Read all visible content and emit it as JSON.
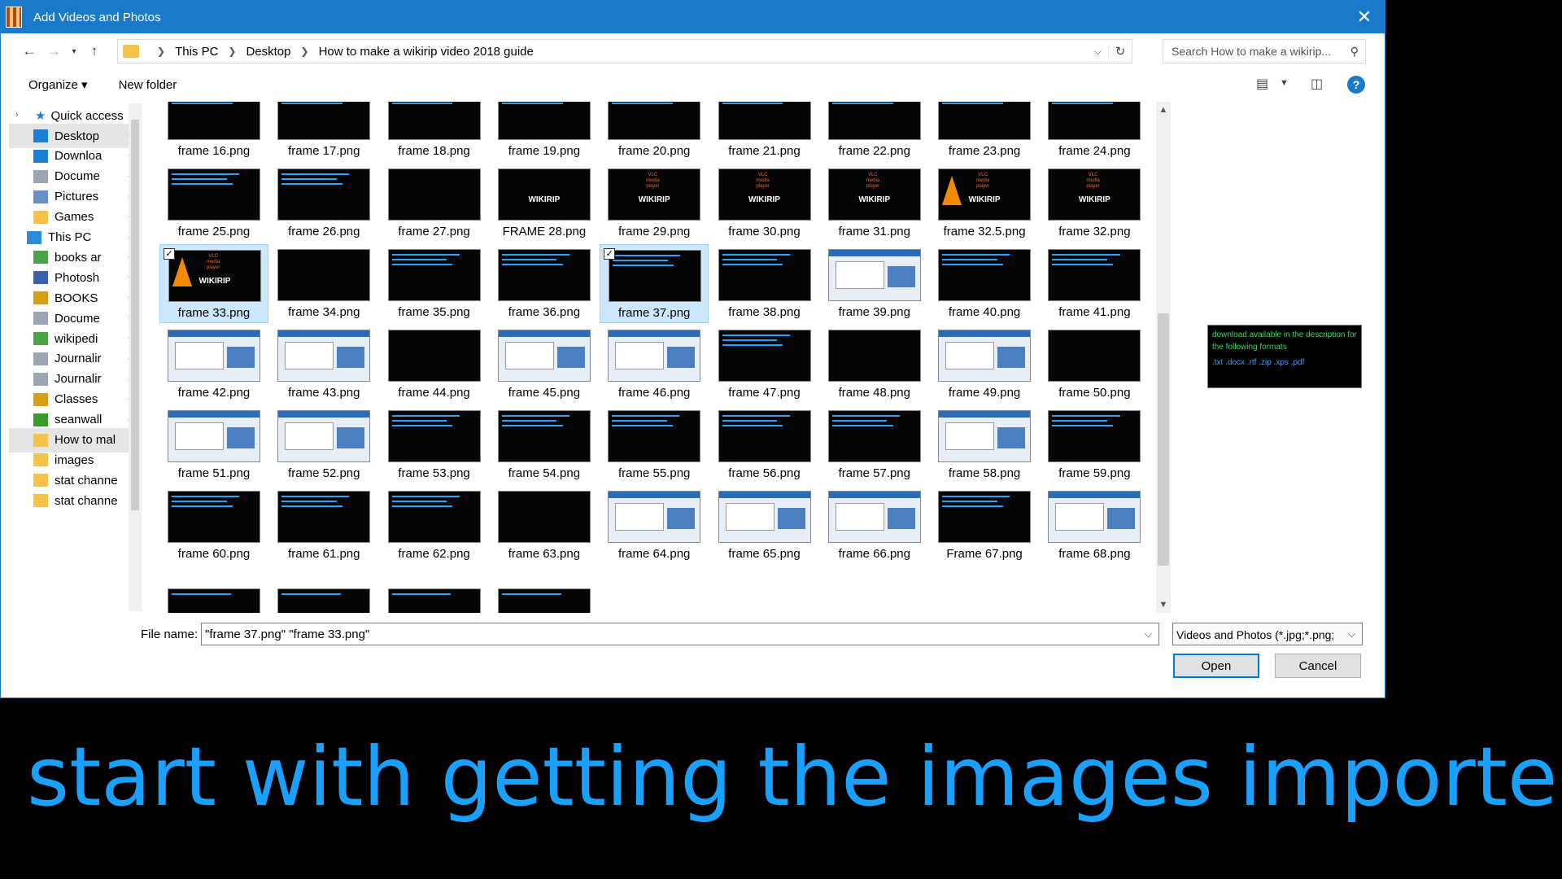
{
  "window": {
    "title": "Add Videos and Photos"
  },
  "address": {
    "crumbs": [
      "This PC",
      "Desktop",
      "How to make a wikirip video 2018 guide"
    ]
  },
  "search": {
    "placeholder": "Search How to make a wikirip..."
  },
  "toolbar": {
    "organize": "Organize ▾",
    "new_folder": "New folder"
  },
  "nav_pane": {
    "quick_access": "Quick access",
    "items": [
      {
        "label": "Desktop",
        "icon": "desktop-icon",
        "color": "#1b7fd6"
      },
      {
        "label": "Downloa",
        "icon": "download-icon",
        "color": "#1b7fd6"
      },
      {
        "label": "Docume",
        "icon": "document-icon",
        "color": "#9aa6b3"
      },
      {
        "label": "Pictures",
        "icon": "pictures-icon",
        "color": "#6a8fc2"
      },
      {
        "label": "Games",
        "icon": "folder-icon",
        "color": "#f6c34a"
      },
      {
        "label": "This PC",
        "icon": "computer-icon",
        "color": "#2a8bd8"
      },
      {
        "label": "books ar",
        "icon": "books-icon",
        "color": "#4aa34a"
      },
      {
        "label": "Photosh",
        "icon": "photoshop-icon",
        "color": "#3d5fb0"
      },
      {
        "label": "BOOKS",
        "icon": "books-folder-icon",
        "color": "#d4a017"
      },
      {
        "label": "Docume",
        "icon": "document-icon",
        "color": "#9aa6b3"
      },
      {
        "label": "wikipedi",
        "icon": "wikipedia-icon",
        "color": "#4aa34a"
      },
      {
        "label": "Journalir",
        "icon": "journal-icon",
        "color": "#9aa6b3"
      },
      {
        "label": "Journalir",
        "icon": "journal-icon",
        "color": "#9aa6b3"
      },
      {
        "label": "Classes",
        "icon": "classes-icon",
        "color": "#d4a017"
      },
      {
        "label": "seanwall",
        "icon": "tree-icon",
        "color": "#3a9a2a"
      },
      {
        "label": "How to mal",
        "icon": "folder-icon",
        "color": "#f6c34a"
      },
      {
        "label": "images",
        "icon": "folder-icon",
        "color": "#f6c34a"
      },
      {
        "label": "stat channe",
        "icon": "folder-icon",
        "color": "#f6c34a"
      },
      {
        "label": "stat channe",
        "icon": "folder-icon",
        "color": "#f6c34a"
      }
    ]
  },
  "files": [
    [
      "frame 16.png",
      "frame 17.png",
      "frame 18.png",
      "frame 19.png",
      "frame 20.png",
      "frame 21.png",
      "frame 22.png",
      "frame 23.png",
      "frame 24.png"
    ],
    [
      "frame 25.png",
      "frame 26.png",
      "frame 27.png",
      "FRAME 28.png",
      "frame 29.png",
      "frame 30.png",
      "frame 31.png",
      "frame 32.5.png",
      "frame 32.png"
    ],
    [
      "frame 33.png",
      "frame 34.png",
      "frame 35.png",
      "frame 36.png",
      "frame 37.png",
      "frame 38.png",
      "frame 39.png",
      "frame 40.png",
      "frame 41.png"
    ],
    [
      "frame 42.png",
      "frame 43.png",
      "frame 44.png",
      "frame 45.png",
      "frame 46.png",
      "frame 47.png",
      "frame 48.png",
      "frame 49.png",
      "frame 50.png"
    ],
    [
      "frame 51.png",
      "frame 52.png",
      "frame 53.png",
      "frame 54.png",
      "frame 55.png",
      "frame 56.png",
      "frame 57.png",
      "frame 58.png",
      "frame 59.png"
    ],
    [
      "frame 60.png",
      "frame 61.png",
      "frame 62.png",
      "frame 63.png",
      "frame 64.png",
      "frame 65.png",
      "frame 66.png",
      "Frame 67.png",
      "frame 68.png"
    ]
  ],
  "selected_files": [
    "frame 33.png",
    "frame 37.png"
  ],
  "thumb_text": {
    "wikirip": "WIKIRIP",
    "vlc": "VLC\nmedia\nplayer"
  },
  "preview": {
    "line1": "download available in the description for the following formats",
    "line2": ".txt .docx .rtf .zip .xps .pdf"
  },
  "file_name": {
    "label": "File name:",
    "value": "\"frame 37.png\" \"frame 33.png\""
  },
  "filter": {
    "value": "Videos and Photos (*.jpg;*.png;"
  },
  "buttons": {
    "open": "Open",
    "cancel": "Cancel"
  },
  "caption": "start with getting the images imported",
  "colors": {
    "accent": "#1979ca",
    "caption": "#1aa0ff",
    "selection": "#cce8ff"
  }
}
